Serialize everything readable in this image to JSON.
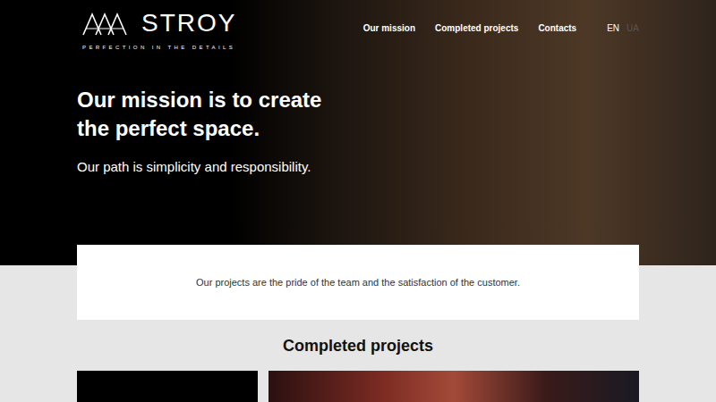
{
  "header": {
    "logo": {
      "name": "STROY",
      "tagline": "PERFECTION IN THE DETAILS"
    },
    "nav": [
      {
        "label": "Our mission"
      },
      {
        "label": "Completed projects"
      },
      {
        "label": "Contacts"
      }
    ],
    "languages": [
      {
        "label": "EN",
        "selected": true
      },
      {
        "label": "UA",
        "selected": false
      }
    ]
  },
  "hero": {
    "title_lines": [
      "Our mission is to create",
      "the perfect space."
    ],
    "subtitle": "Our path is simplicity and responsibility."
  },
  "intro_card": {
    "text": "Our projects are the pride of the team and the satisfaction of the customer."
  },
  "projects": {
    "heading": "Completed projects"
  }
}
